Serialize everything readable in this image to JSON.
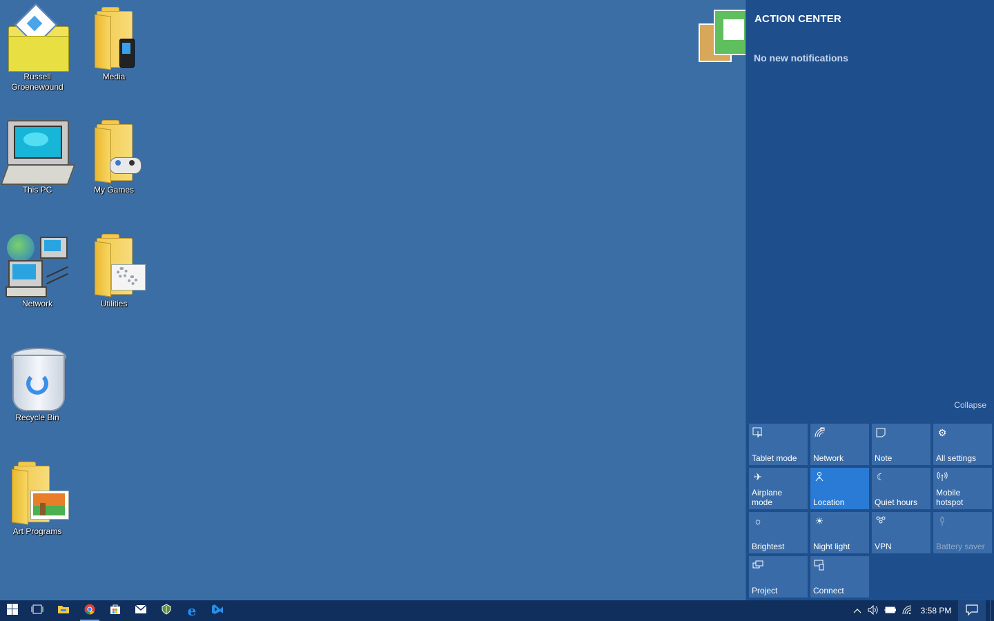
{
  "desktop": {
    "icons": [
      {
        "label": "Russell\nGroenewound",
        "line1": "Russell",
        "line2": "Groenewound"
      },
      {
        "label": "Media"
      },
      {
        "label": "This PC"
      },
      {
        "label": "My Games"
      },
      {
        "label": "Network"
      },
      {
        "label": "Utilities"
      },
      {
        "label": "Recycle Bin"
      },
      {
        "label": "Art Programs"
      }
    ]
  },
  "action_center": {
    "title": "ACTION CENTER",
    "empty_message": "No new notifications",
    "collapse_label": "Collapse",
    "quick_actions": [
      {
        "label": "Tablet mode",
        "icon": "tablet-mode-icon",
        "state": "off"
      },
      {
        "label": "Network",
        "icon": "network-icon",
        "state": "off"
      },
      {
        "label": "Note",
        "icon": "note-icon",
        "state": "off"
      },
      {
        "label": "All settings",
        "icon": "settings-gear-icon",
        "state": "off"
      },
      {
        "label": "Airplane mode",
        "icon": "airplane-icon",
        "state": "off"
      },
      {
        "label": "Location",
        "icon": "location-icon",
        "state": "on"
      },
      {
        "label": "Quiet hours",
        "icon": "moon-icon",
        "state": "off"
      },
      {
        "label": "Mobile hotspot",
        "icon": "hotspot-icon",
        "state": "off"
      },
      {
        "label": "Brightest",
        "icon": "brightness-icon",
        "state": "off"
      },
      {
        "label": "Night light",
        "icon": "night-light-icon",
        "state": "off"
      },
      {
        "label": "VPN",
        "icon": "vpn-icon",
        "state": "off"
      },
      {
        "label": "Battery saver",
        "icon": "battery-saver-icon",
        "state": "disabled"
      },
      {
        "label": "Project",
        "icon": "project-icon",
        "state": "off"
      },
      {
        "label": "Connect",
        "icon": "connect-icon",
        "state": "off"
      }
    ]
  },
  "taskbar": {
    "apps": [
      {
        "name": "start-button"
      },
      {
        "name": "task-view-button"
      },
      {
        "name": "file-explorer-button"
      },
      {
        "name": "chrome-button"
      },
      {
        "name": "store-button"
      },
      {
        "name": "mail-button"
      },
      {
        "name": "shield-app-button"
      },
      {
        "name": "edge-button"
      },
      {
        "name": "visual-studio-button"
      }
    ],
    "clock": "3:58 PM"
  },
  "colors": {
    "desktop": "#3b6ea5",
    "action_center": "#1f4e8c",
    "tile": "#386ba7",
    "tile_active": "#2a7bd6",
    "taskbar": "#102f5c"
  }
}
